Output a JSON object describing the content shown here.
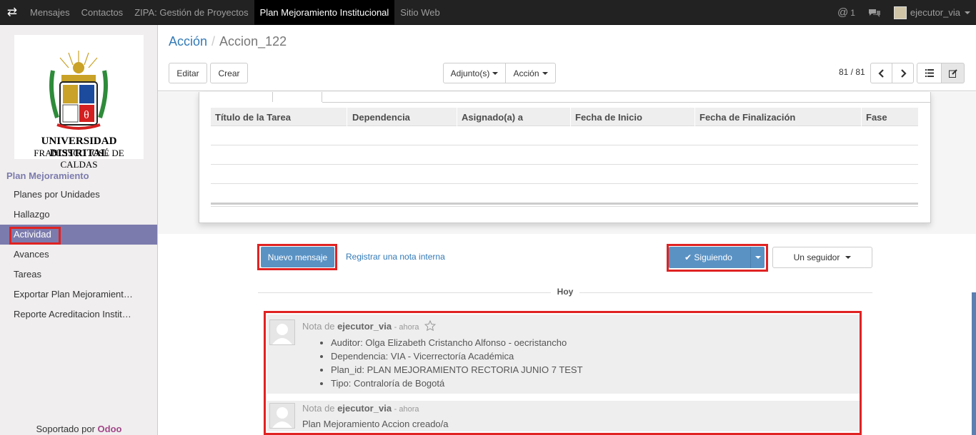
{
  "topbar": {
    "menu": [
      "Mensajes",
      "Contactos",
      "ZIPA: Gestión de Proyectos",
      "Plan Mejoramiento Institucional",
      "Sitio Web"
    ],
    "mentions": "1",
    "user": "ejecutor_via"
  },
  "sidebar": {
    "logo_line1": "UNIVERSIDAD DISTRITAL",
    "logo_line2": "FRANCISCO JOSÉ DE CALDAS",
    "section": "Plan Mejoramiento",
    "items": [
      "Planes por Unidades",
      "Hallazgo",
      "Actividad",
      "Avances",
      "Tareas",
      "Exportar Plan Mejoramient…",
      "Reporte Acreditacion Instit…"
    ],
    "active_index": 2,
    "footer_prefix": "Soportado por",
    "footer_brand": "Odoo"
  },
  "breadcrumb": {
    "parent": "Acción",
    "current": "Accion_122"
  },
  "toolbar": {
    "edit": "Editar",
    "create": "Crear",
    "attach": "Adjunto(s)",
    "action": "Acción",
    "pager": "81 / 81"
  },
  "table": {
    "columns": [
      "Título de la Tarea",
      "Dependencia",
      "Asignado(a) a",
      "Fecha de Inicio",
      "Fecha de Finalización",
      "Fase"
    ]
  },
  "chatter": {
    "new_message": "Nuevo mensaje",
    "log_note": "Registrar una nota interna",
    "following": "Siguiendo",
    "followers": "Un seguidor",
    "day": "Hoy",
    "messages": [
      {
        "prefix": "Nota de",
        "author": "ejecutor_via",
        "time": "- ahora",
        "items": [
          "Auditor: Olga Elizabeth Cristancho Alfonso - oecristancho",
          "Dependencia: VIA - Vicerrectoría Académica",
          "Plan_id: PLAN MEJORAMIENTO RECTORIA JUNIO 7 TEST",
          "Tipo: Contraloría de Bogotá"
        ]
      },
      {
        "prefix": "Nota de",
        "author": "ejecutor_via",
        "time": "- ahora",
        "body": "Plan Mejoramiento Accion creado/a"
      }
    ]
  },
  "colors": {
    "accent": "#7c7bad",
    "primary": "#5a92c4",
    "highlight": "#e02222"
  }
}
